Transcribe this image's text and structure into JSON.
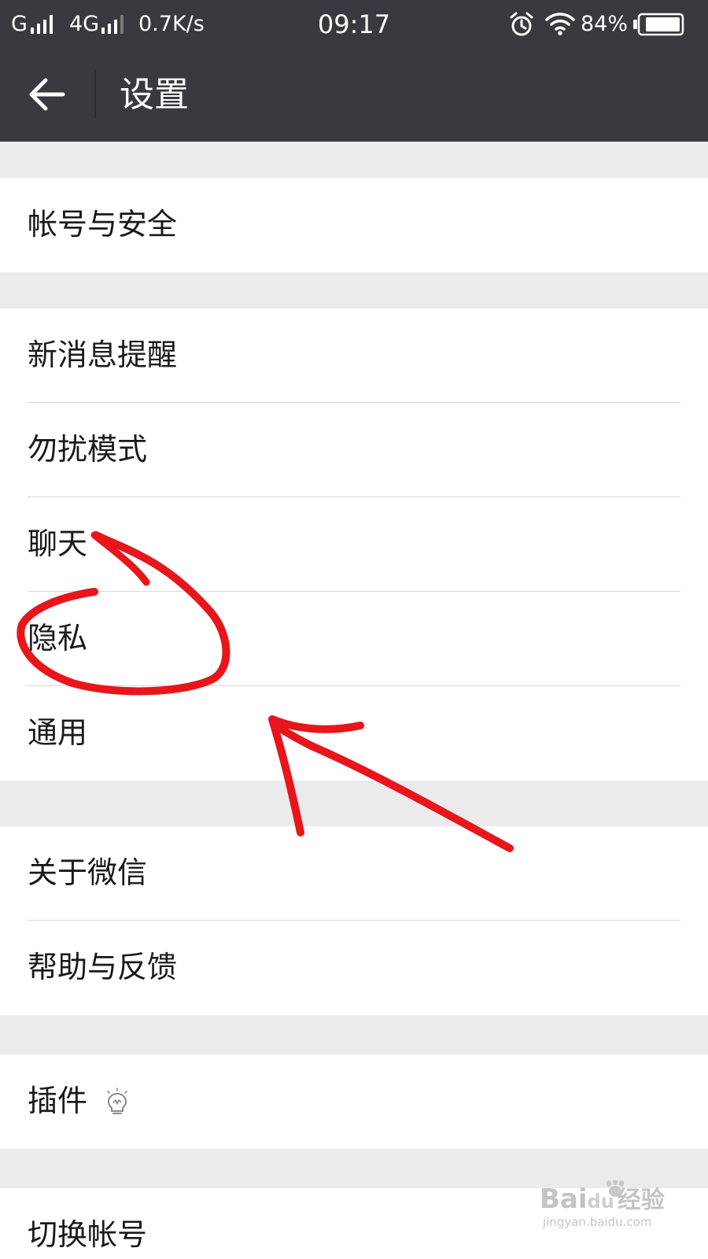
{
  "status_bar": {
    "carrier1": "G",
    "network2": "4G",
    "speed": "0.7K/s",
    "time": "09:17",
    "battery": "84%",
    "icons": [
      "signal-icon",
      "signal-icon",
      "alarm-icon",
      "wifi-icon",
      "battery-icon"
    ]
  },
  "header": {
    "title": "设置",
    "back_icon": "arrow-left-icon"
  },
  "groups": [
    {
      "items": [
        {
          "label": "帐号与安全"
        }
      ]
    },
    {
      "items": [
        {
          "label": "新消息提醒"
        },
        {
          "label": "勿扰模式"
        },
        {
          "label": "聊天"
        },
        {
          "label": "隐私"
        },
        {
          "label": "通用"
        }
      ]
    },
    {
      "items": [
        {
          "label": "关于微信"
        },
        {
          "label": "帮助与反馈"
        }
      ]
    },
    {
      "items": [
        {
          "label": "插件",
          "icon": "lightbulb-icon"
        }
      ]
    },
    {
      "items": [
        {
          "label": "切换帐号"
        }
      ]
    }
  ],
  "watermark": {
    "brand": "Bai",
    "brand_paw": "du",
    "suffix": "经验",
    "url": "jingyan.baidu.com"
  },
  "colors": {
    "header_bg": "#393a3f",
    "page_bg": "#ebebeb",
    "row_bg": "#ffffff",
    "annotation": "#e8151b"
  }
}
